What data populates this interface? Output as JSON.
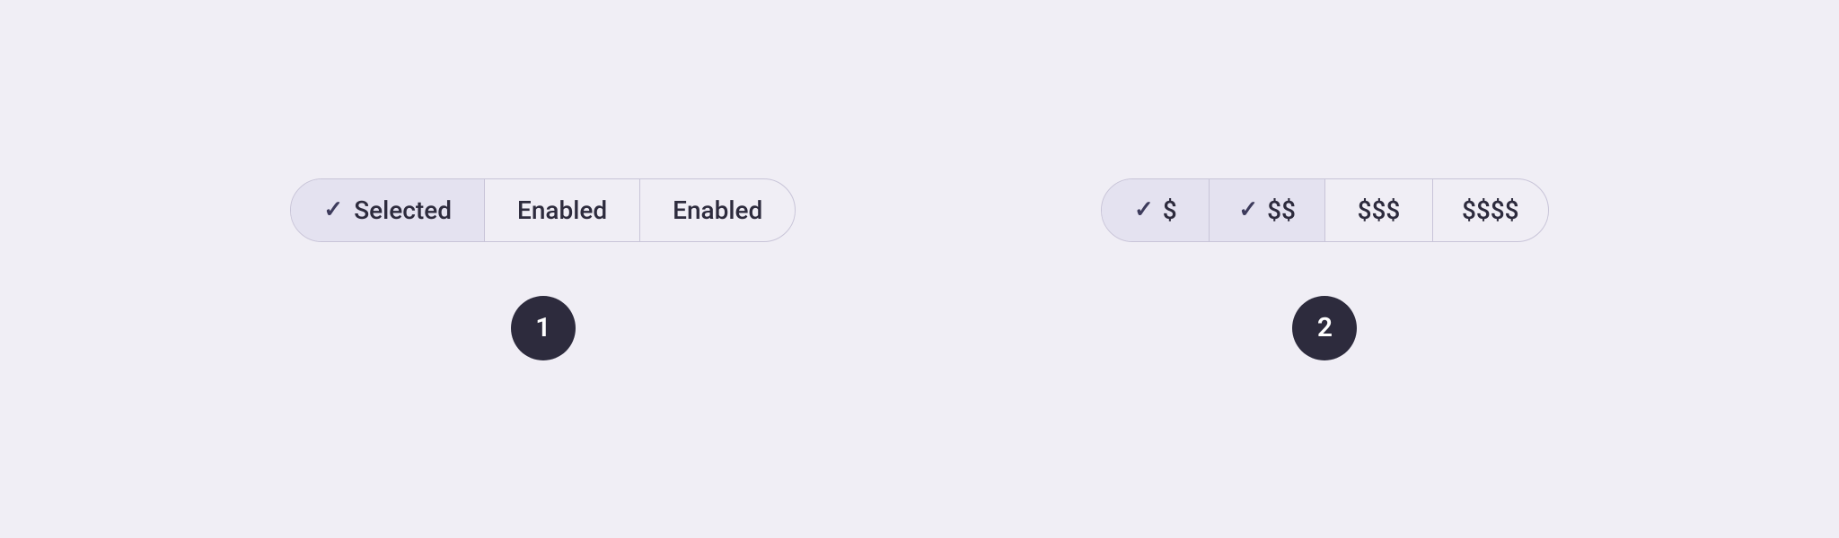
{
  "background_color": "#f0eef5",
  "example1": {
    "segments": [
      {
        "id": "selected",
        "label": "Selected",
        "state": "selected",
        "has_check": true
      },
      {
        "id": "enabled1",
        "label": "Enabled",
        "state": "enabled",
        "has_check": false
      },
      {
        "id": "enabled2",
        "label": "Enabled",
        "state": "enabled",
        "has_check": false
      }
    ],
    "badge": {
      "label": "1"
    }
  },
  "example2": {
    "segments": [
      {
        "id": "price1",
        "label": "$",
        "state": "selected",
        "has_check": true
      },
      {
        "id": "price2",
        "label": "$$",
        "state": "selected",
        "has_check": true
      },
      {
        "id": "price3",
        "label": "$$$",
        "state": "plain",
        "has_check": false
      },
      {
        "id": "price4",
        "label": "$$$$",
        "state": "plain",
        "has_check": false
      }
    ],
    "badge": {
      "label": "2"
    }
  },
  "labels": {
    "check": "✓"
  }
}
